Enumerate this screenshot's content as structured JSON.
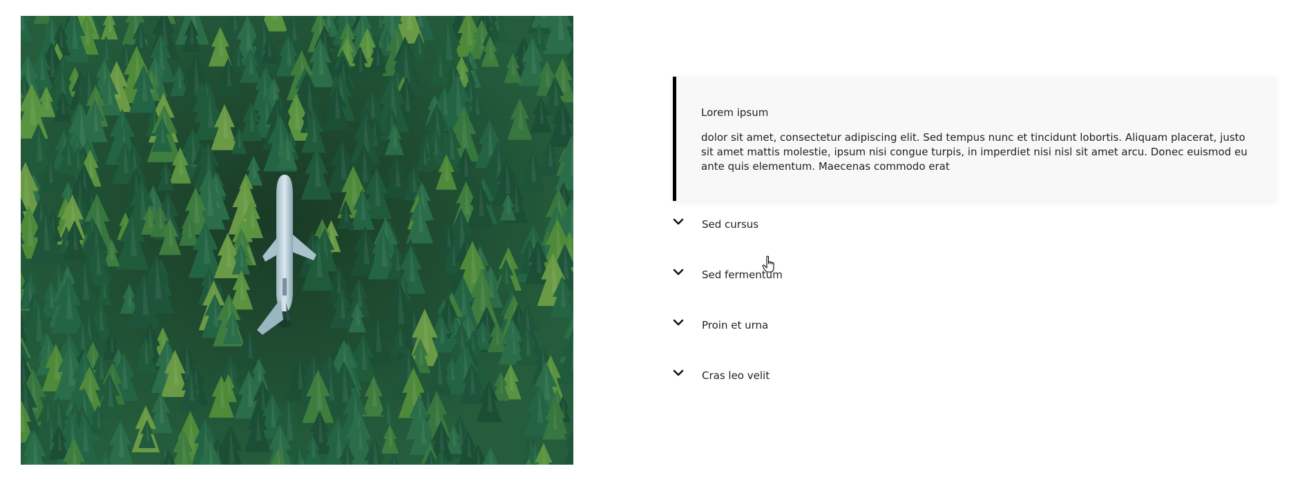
{
  "image": {
    "alt": "",
    "icon": "forest-photo"
  },
  "accordion": {
    "open_item": {
      "title": "Lorem ipsum",
      "body": "dolor sit amet, consectetur adipiscing elit. Sed tempus nunc et tincidunt lobortis. Aliquam placerat, justo sit amet mattis molestie, ipsum nisi congue turpis, in imperdiet nisi nisl sit amet arcu. Donec euismod eu ante quis elementum. Maecenas commodo erat"
    },
    "items": [
      {
        "label": "Sed cursus",
        "icon": "chevron-down-icon"
      },
      {
        "label": "Sed fermentum",
        "icon": "chevron-down-icon"
      },
      {
        "label": "Proin et urna",
        "icon": "chevron-down-icon"
      },
      {
        "label": "Cras leo velit",
        "icon": "chevron-down-icon"
      }
    ]
  },
  "colors": {
    "accent_border": "#000000",
    "panel_bg": "#f8f8f8",
    "text": "#1f1f1f",
    "forest_dark": "#1d4d33",
    "forest_light": "#4f8a3a",
    "plane": "#b8cdd6"
  }
}
